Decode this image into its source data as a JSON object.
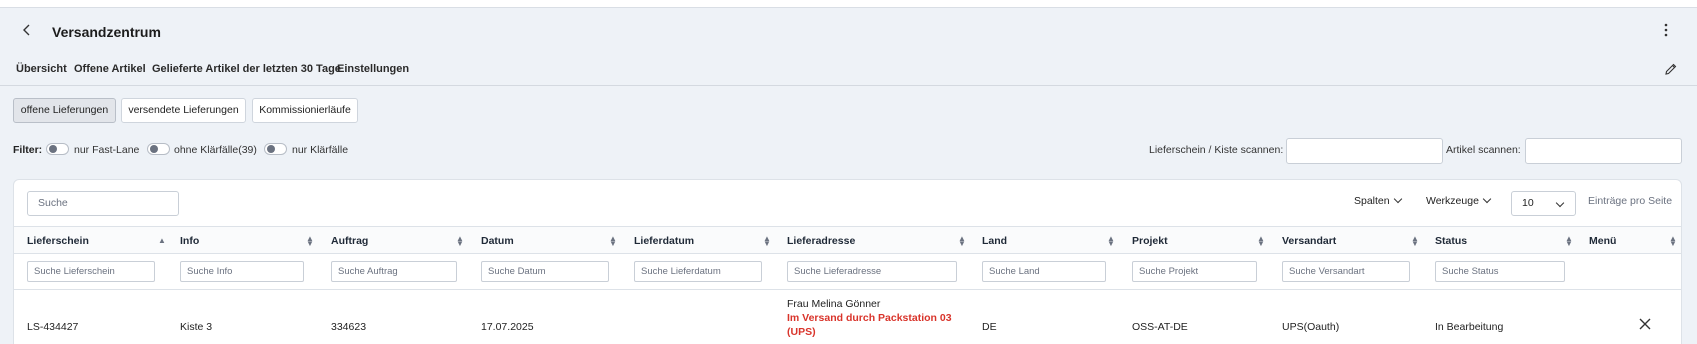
{
  "header": {
    "title": "Versandzentrum"
  },
  "nav": {
    "items": [
      "Übersicht",
      "Offene Artikel",
      "Gelieferte Artikel der letzten 30 Tage",
      "Einstellungen"
    ]
  },
  "tabs": {
    "open": "offene Lieferungen",
    "sent": "versendete Lieferungen",
    "picking": "Kommissionierläufe",
    "active": "offene Lieferungen"
  },
  "filter": {
    "label": "Filter:",
    "fastlane": "nur Fast-Lane",
    "ohne": "ohne Klärfälle(39)",
    "nur": "nur Klärfälle",
    "scan_lieferschein": "Lieferschein / Kiste scannen:",
    "scan_artikel": "Artikel scannen:"
  },
  "table_tools": {
    "search_placeholder": "Suche",
    "spalten": "Spalten",
    "werkzeuge": "Werkzeuge",
    "per_page": "10",
    "per_page_label": "Einträge pro Seite"
  },
  "columns": [
    "Lieferschein",
    "Info",
    "Auftrag",
    "Datum",
    "Lieferdatum",
    "Lieferadresse",
    "Land",
    "Projekt",
    "Versandart",
    "Status",
    "Menü"
  ],
  "column_filters": [
    "Suche Lieferschein",
    "Suche Info",
    "Suche Auftrag",
    "Suche Datum",
    "Suche Lieferdatum",
    "Suche Lieferadresse",
    "Suche Land",
    "Suche Projekt",
    "Suche Versandart",
    "Suche Status"
  ],
  "row": {
    "lieferschein": "LS-434427",
    "info": "Kiste 3",
    "auftrag": "334623",
    "datum": "17.07.2025",
    "lieferdatum": "",
    "adresse_name": "Frau Melina Gönner",
    "adresse_status": "Im Versand durch Packstation 03 (UPS)",
    "land": "DE",
    "projekt": "OSS-AT-DE",
    "versandart": "UPS(Oauth)",
    "status": "In Bearbeitung"
  },
  "colors": {
    "accent_red": "#d9342b",
    "background": "#eef2f7"
  }
}
